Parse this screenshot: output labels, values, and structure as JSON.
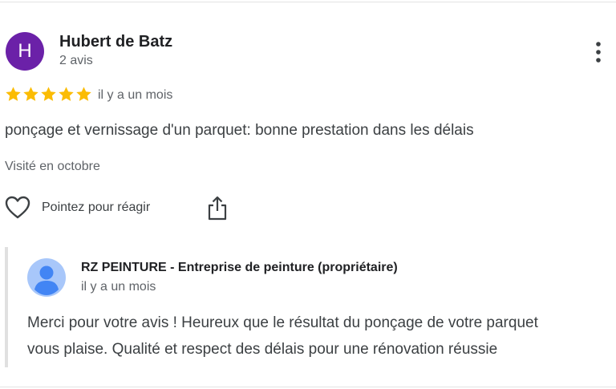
{
  "review": {
    "avatar_letter": "H",
    "avatar_color": "#6b21a8",
    "reviewer_name": "Hubert de Batz",
    "review_count": "2 avis",
    "rating": 5,
    "rating_max": 5,
    "star_color": "#fbbc04",
    "date": "il y a un mois",
    "text": "ponçage et vernissage d'un parquet: bonne prestation dans les délais",
    "visited": "Visité en octobre",
    "more_icon": "more-vertical-icon"
  },
  "actions": {
    "like_icon": "heart-icon",
    "react_label": "Pointez pour réagir",
    "share_icon": "share-icon"
  },
  "owner_reply": {
    "avatar_icon": "default-profile-icon",
    "name": "RZ PEINTURE - Entreprise de peinture (propriétaire)",
    "date": "il y a un mois",
    "text_lines": [
      "Merci pour votre avis ! Heureux que le résultat du ponçage de votre parquet",
      "vous plaise. Qualité et respect des délais pour une rénovation réussie"
    ]
  }
}
